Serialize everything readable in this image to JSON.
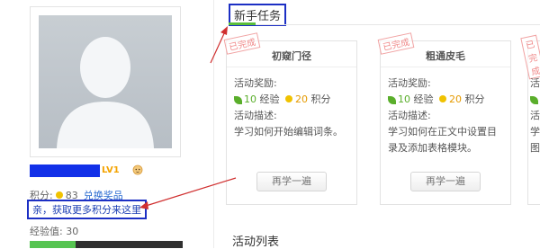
{
  "profile": {
    "level_badge": "LV1",
    "points_label": "积分:",
    "points_value": "83",
    "redeem_link": "兑换奖品",
    "promo_link": "亲，获取更多积分来这里",
    "xp_label": "经验值:",
    "xp_value": "30",
    "xp_progress_fraction": 0.3
  },
  "tasks": {
    "title": "新手任务",
    "cards": [
      {
        "stamp": "已完成",
        "title": "初窥门径",
        "reward_label": "活动奖励:",
        "xp": "10",
        "xp_unit": "经验",
        "points": "20",
        "points_unit": "积分",
        "desc_label": "活动描述:",
        "desc": "学习如何开始编辑词条。",
        "button": "再学一遍"
      },
      {
        "stamp": "已完成",
        "title": "粗通皮毛",
        "reward_label": "活动奖励:",
        "xp": "10",
        "xp_unit": "经验",
        "points": "20",
        "points_unit": "积分",
        "desc_label": "活动描述:",
        "desc": "学习如何在正文中设置目录及添加表格模块。",
        "button": "再学一遍"
      },
      {
        "stamp": "已完成",
        "title": "",
        "reward_label": "活",
        "xp": "",
        "xp_unit": "",
        "points": "",
        "points_unit": "",
        "desc_label": "活",
        "desc": "学图",
        "button": ""
      }
    ]
  },
  "activity_list": {
    "title": "活动列表"
  },
  "colors": {
    "highlight_border": "#1c2fc4",
    "stamp_red": "#f08a8a",
    "xp_green": "#5aae2b",
    "points_orange": "#e59a00",
    "xp_bar_fill": "#56c451"
  }
}
